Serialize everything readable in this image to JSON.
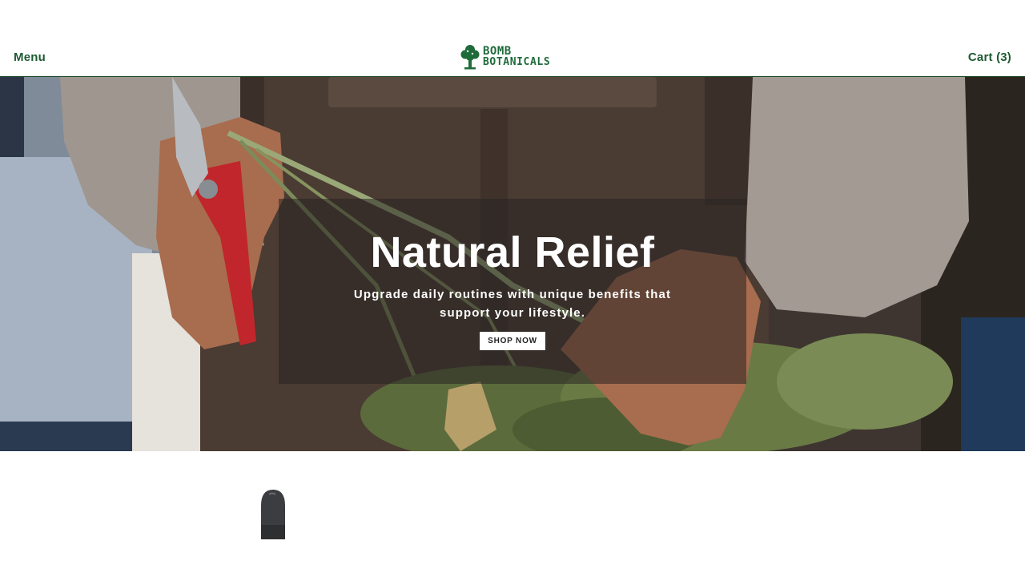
{
  "header": {
    "menu_label": "Menu",
    "logo_line1": "BOMB",
    "logo_line2": "BOTANICALS",
    "cart_label": "Cart (3)"
  },
  "hero": {
    "title": "Natural Relief",
    "subtitle": "Upgrade daily routines with unique benefits that support your lifestyle.",
    "cta_label": "SHOP NOW"
  },
  "colors": {
    "brand_green": "#1f6b3a",
    "overlay": "rgba(40,36,34,0.55)"
  },
  "icons": [
    "tree-logo-icon",
    "dropper-bottle-icon"
  ]
}
